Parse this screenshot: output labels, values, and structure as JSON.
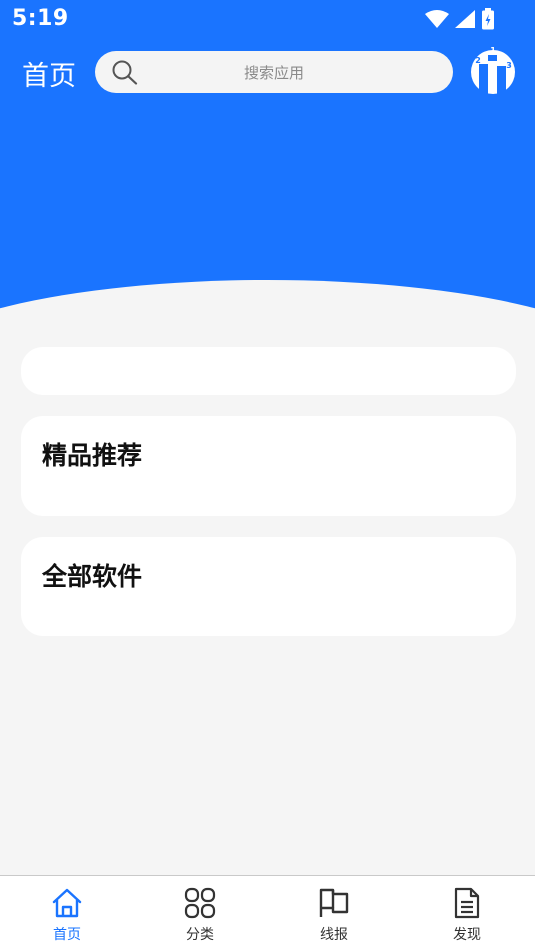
{
  "status_bar": {
    "time": "5:19"
  },
  "header": {
    "title": "首页",
    "search_placeholder": "搜索应用",
    "rank_icon_numbers": [
      "1",
      "2",
      "3"
    ]
  },
  "sections": [
    {
      "title": ""
    },
    {
      "title": "精品推荐"
    },
    {
      "title": "全部软件"
    }
  ],
  "tabbar": {
    "items": [
      {
        "label": "首页",
        "icon": "home-icon",
        "active": true
      },
      {
        "label": "分类",
        "icon": "category-grid-icon",
        "active": false
      },
      {
        "label": "线报",
        "icon": "flag-icon",
        "active": false
      },
      {
        "label": "发现",
        "icon": "document-icon",
        "active": false
      }
    ]
  },
  "colors": {
    "primary": "#1a74ff",
    "background": "#f5f5f5"
  }
}
